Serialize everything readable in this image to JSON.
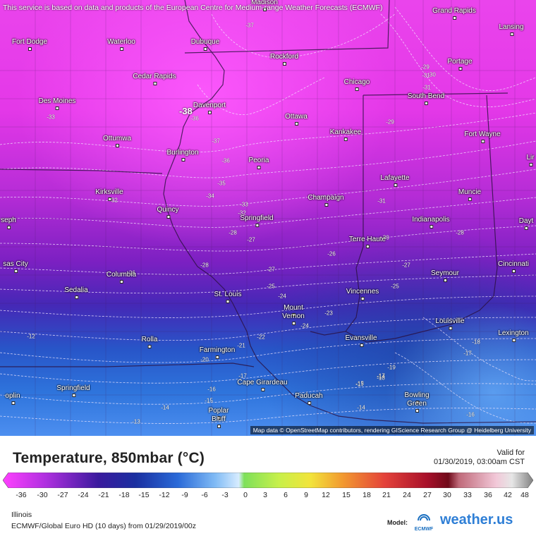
{
  "notice": "This service is based on data and products of the European Centre for Medium-range Weather Forecasts (ECMWF)",
  "attribution": "Map data © OpenStreetMap contributors, rendering GIScience Research Group @ Heidelberg University",
  "min_marker": "-38",
  "cities": [
    {
      "name": "Fort Dodge"
    },
    {
      "name": "Waterloo"
    },
    {
      "name": "Dubuque"
    },
    {
      "name": "Madison"
    },
    {
      "name": "Grand Rapids"
    },
    {
      "name": "Lansing"
    },
    {
      "name": "Rockford"
    },
    {
      "name": "Portage"
    },
    {
      "name": "Cedar Rapids"
    },
    {
      "name": "Chicago"
    },
    {
      "name": "South Bend"
    },
    {
      "name": "Des Moines"
    },
    {
      "name": "Davenport"
    },
    {
      "name": "Ottawa"
    },
    {
      "name": "Kankakee"
    },
    {
      "name": "Fort Wayne"
    },
    {
      "name": "Ottumwa"
    },
    {
      "name": "Burlington"
    },
    {
      "name": "Peoria"
    },
    {
      "name": "Lafayette"
    },
    {
      "name": "Kirksville"
    },
    {
      "name": "Muncie"
    },
    {
      "name": "Champaign"
    },
    {
      "name": "Quincy"
    },
    {
      "name": "Springfield"
    },
    {
      "name": "Indianapolis"
    },
    {
      "name": "seph"
    },
    {
      "name": "Dayt"
    },
    {
      "name": "Terre Haute"
    },
    {
      "name": "sas City"
    },
    {
      "name": "Columbia"
    },
    {
      "name": "Seymour"
    },
    {
      "name": "Cincinnati"
    },
    {
      "name": "Sedalia"
    },
    {
      "name": "St. Louis"
    },
    {
      "name": "Vincennes"
    },
    {
      "name": "Mount"
    },
    {
      "name": "Vernon"
    },
    {
      "name": "Louisville"
    },
    {
      "name": "Rolla"
    },
    {
      "name": "Farmington"
    },
    {
      "name": "Evansville"
    },
    {
      "name": "Lexington"
    },
    {
      "name": "Springfield"
    },
    {
      "name": "Cape Girardeau"
    },
    {
      "name": "Paducah"
    },
    {
      "name": "Bowling"
    },
    {
      "name": "Green"
    },
    {
      "name": "oplin"
    },
    {
      "name": "Poplar"
    },
    {
      "name": "Bluff"
    },
    {
      "name": "Lir"
    }
  ],
  "isotherm_labels": [
    "-37",
    "-33",
    "-36",
    "-37",
    "-36",
    "-35",
    "-34",
    "-33",
    "-32",
    "-29",
    "-30",
    "-31",
    "-29",
    "-31",
    "-30",
    "-32",
    "-28",
    "-27",
    "-28",
    "-26",
    "-27",
    "-25",
    "-26",
    "-27",
    "-24",
    "-25",
    "-23",
    "-24",
    "-22",
    "-21",
    "-20",
    "-19",
    "-18",
    "-17",
    "-16",
    "-15",
    "-14",
    "-13",
    "-12",
    "-17",
    "-18",
    "-17",
    "-16",
    "-14",
    "-15",
    "-14",
    "-17",
    "-31",
    "-28"
  ],
  "title": "Temperature, 850mbar (°C)",
  "valid_for_label": "Valid for",
  "valid_time": "01/30/2019, 03:00am CST",
  "legend_ticks": [
    "-36",
    "-30",
    "-27",
    "-24",
    "-21",
    "-18",
    "-15",
    "-12",
    "-9",
    "-6",
    "-3",
    "0",
    "3",
    "6",
    "9",
    "12",
    "15",
    "18",
    "21",
    "24",
    "27",
    "30",
    "33",
    "36",
    "42",
    "48"
  ],
  "region": "Illinois",
  "model": "ECMWF/Global Euro HD (10 days) from 01/29/2019/00z",
  "model_label": "Model:",
  "ecmwf_logo_text": "ECMWF",
  "brand": "weather.us",
  "colors": {
    "cold_magenta": "#ee3cf0",
    "purple": "#7a1fc4",
    "blue": "#2461d8",
    "light_blue": "#66a8f5"
  }
}
